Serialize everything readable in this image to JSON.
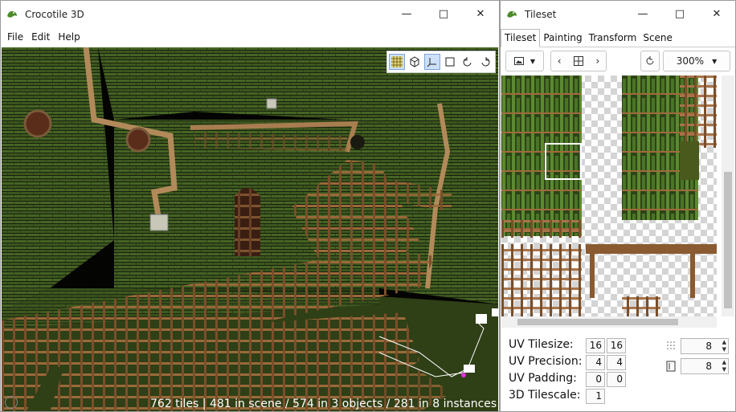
{
  "main_window": {
    "title": "Crocotile 3D",
    "menu": [
      "File",
      "Edit",
      "Help"
    ],
    "status": "762 tiles | 481 in scene / 574 in 3 objects / 281 in 8 instances"
  },
  "tileset_window": {
    "title": "Tileset",
    "tabs": [
      "Tileset",
      "Painting",
      "Transform",
      "Scene"
    ],
    "zoom": "300%",
    "uv_tilesize_label": "UV Tilesize:",
    "uv_tilesize": [
      "16",
      "16"
    ],
    "uv_precision_label": "UV Precision:",
    "uv_precision": [
      "4",
      "4"
    ],
    "uv_padding_label": "UV Padding:",
    "uv_padding": [
      "0",
      "0"
    ],
    "tilescale_label": "3D Tilescale:",
    "tilescale": "1",
    "grid_w": "8",
    "grid_h": "8"
  }
}
